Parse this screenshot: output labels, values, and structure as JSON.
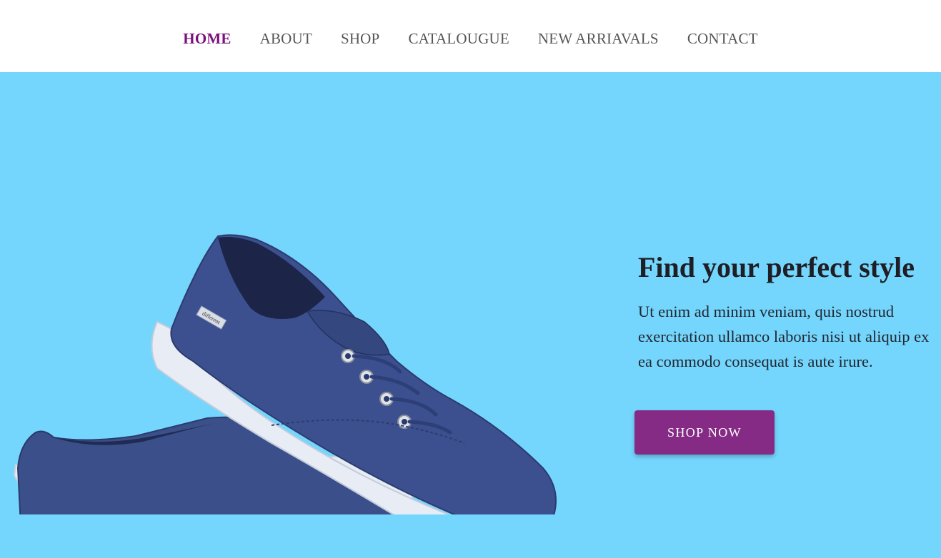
{
  "nav": {
    "items": [
      {
        "label": "HOME",
        "active": true
      },
      {
        "label": "ABOUT",
        "active": false
      },
      {
        "label": "SHOP",
        "active": false
      },
      {
        "label": "CATALOUGUE",
        "active": false
      },
      {
        "label": "NEW ARRIAVALS",
        "active": false
      },
      {
        "label": "CONTACT",
        "active": false
      }
    ]
  },
  "hero": {
    "title": "Find your perfect style",
    "text": "Ut enim ad minim veniam, quis nostrud exercitation ullamco laboris nisi ut aliquip ex ea commodo consequat is aute irure.",
    "button_label": "SHOP NOW",
    "image_alt": "pair of blue canvas sneakers",
    "tag_text": "different"
  },
  "colors": {
    "hero_bg": "#74d6fd",
    "accent": "#852b85",
    "nav_active": "#7a0f7e",
    "nav_text": "#555555",
    "shoe_canvas": "#3a4f8c",
    "sole": "#e8edf5"
  }
}
